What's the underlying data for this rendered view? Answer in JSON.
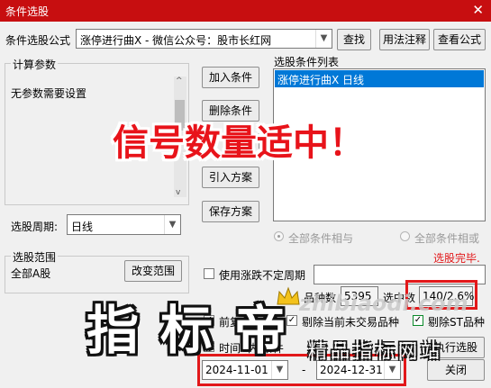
{
  "window": {
    "title": "条件选股",
    "close_glyph": "✕"
  },
  "formula": {
    "label": "条件选股公式",
    "value": "涨停进行曲X - 微信公众号：股市长红网",
    "find_button": "查找",
    "usage_button": "用法注释",
    "view_button": "查看公式"
  },
  "params": {
    "group_title": "计算参数",
    "text": "无参数需要设置"
  },
  "actions": {
    "add": "加入条件",
    "delete": "删除条件",
    "hidden": "",
    "import": "引入方案",
    "save": "保存方案"
  },
  "condition_list": {
    "title": "选股条件列表",
    "items": [
      "涨停进行曲X  日线"
    ]
  },
  "period": {
    "label": "选股周期:",
    "value": "日线"
  },
  "logic": {
    "and_label": "全部条件相与",
    "or_label": "全部条件相或"
  },
  "status": {
    "text": "选股完毕.",
    "color": "#e2181a"
  },
  "scope": {
    "group_title": "选股范围",
    "value": "全部A股",
    "change_button": "改变范围"
  },
  "variable_period": {
    "label": "使用涨跌不定周期"
  },
  "stats": {
    "count_label": "品种数",
    "count_value": "5395",
    "selected_label": "选中数",
    "selected_value": "140/2.6%"
  },
  "options": {
    "pre_label": "前复",
    "exclude_untraded": "剔除当前未交易品种",
    "exclude_st": "剔除ST品种",
    "time_label": "时间",
    "condition_label": "内 条件"
  },
  "date_range": {
    "start": "2024-11-01",
    "separator": "-",
    "end": "2024-12-31"
  },
  "footer": {
    "execute_button": "执行选股",
    "close_button": "关闭"
  },
  "overlays": {
    "headline": "信号数量适中！",
    "watermark_chars": [
      "指",
      "标",
      "帝"
    ],
    "site_name": "精品指标网站",
    "url": "zhibiaodi.com",
    "crown_icon": "crown-icon"
  },
  "colors": {
    "titlebar": "#c70e10",
    "selection": "#0078d7",
    "highlight_frame": "#e2181a",
    "headline": "#e8131a"
  }
}
